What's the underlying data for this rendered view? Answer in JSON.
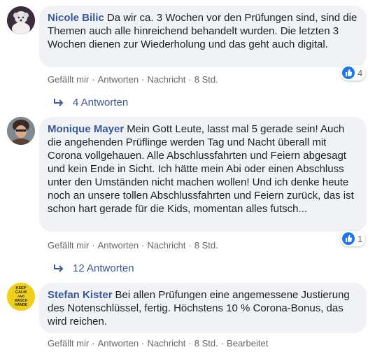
{
  "comments": [
    {
      "author": "Nicole Bilic",
      "text": "Da wir ca. 3 Wochen vor den Prüfungen sind, sind die Themen auch alle hinreichend behandelt wurden. Die letzten 3 Wochen dienen zur Wiederholung und das geht auch digital.",
      "actions": {
        "like": "Gefällt mir",
        "reply": "Antworten",
        "message": "Nachricht",
        "time": "8 Std."
      },
      "reaction_count": "4",
      "replies_label": "4 Antworten"
    },
    {
      "author": "Monique Mayer",
      "text": "Mein Gott Leute, lasst mal 5 gerade sein! Auch die angehenden Prüflinge werden Tag und Nacht überall mit Corona vollgehauen. Alle Abschlussfahrten und Feiern abgesagt und kein Ende in Sicht. Ich hätte mein Abi oder einen Abschluss unter den Umständen nicht machen wollen! Und ich denke heute noch an unsere tollen Abschlussfahrten und Feiern zurück, das ist schon hart gerade für die Kids, momentan alles futsch...",
      "actions": {
        "like": "Gefällt mir",
        "reply": "Antworten",
        "message": "Nachricht",
        "time": "8 Std."
      },
      "reaction_count": "1",
      "replies_label": "12 Antworten"
    },
    {
      "author": "Stefan Kister",
      "text": "Bei allen Prüfungen eine angemessene Justierung des Notenschlüssel, fertig. Höchstens 10 % Corona-Bonus, das wird reichen.",
      "actions": {
        "like": "Gefällt mir",
        "reply": "Antworten",
        "message": "Nachricht",
        "time": "8 Std.",
        "edited": "Bearbeitet"
      },
      "avatar_text": [
        "KEEP",
        "CALM",
        "AND",
        "WASCH",
        "HÄNDE"
      ]
    }
  ],
  "colors": {
    "author": "#385898",
    "bubble": "#f0f2f5",
    "meta": "#65676b",
    "like": "#1877f2"
  }
}
